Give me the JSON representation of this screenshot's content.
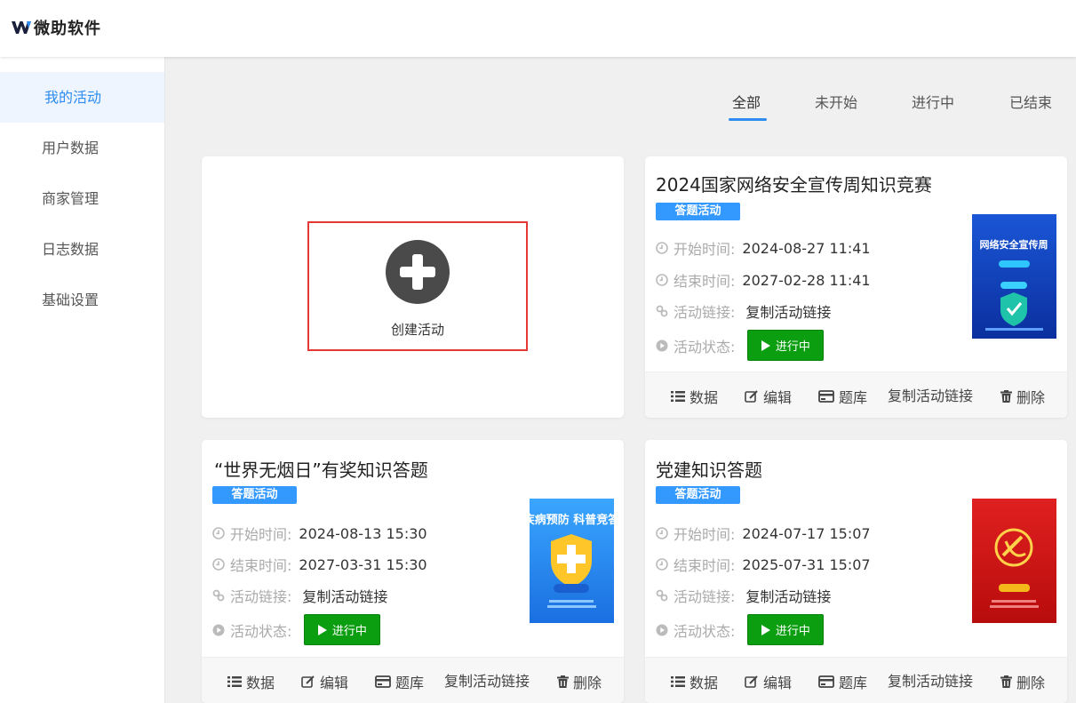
{
  "header": {
    "logo_text": "微助软件"
  },
  "sidebar": {
    "items": [
      {
        "label": "我的活动",
        "active": true
      },
      {
        "label": "用户数据"
      },
      {
        "label": "商家管理"
      },
      {
        "label": "日志数据"
      },
      {
        "label": "基础设置"
      }
    ]
  },
  "tabs": [
    {
      "label": "全部",
      "active": true
    },
    {
      "label": "未开始"
    },
    {
      "label": "进行中"
    },
    {
      "label": "已结束"
    }
  ],
  "create": {
    "label": "创建活动"
  },
  "labels": {
    "start": "开始时间:",
    "end": "结束时间:",
    "link": "活动链接:",
    "status": "活动状态:",
    "copy_link": "复制活动链接"
  },
  "actions": {
    "data": "数据",
    "edit": "编辑",
    "bank": "题库",
    "copy_link": "复制活动链接",
    "delete": "删除"
  },
  "activities": [
    {
      "title": "2024国家网络安全宣传周知识竞赛",
      "badge": "答题活动",
      "start": "2024-08-27 11:41",
      "end": "2027-02-28 11:41",
      "status": "进行中",
      "thumb_text": "网络安全宣传周"
    },
    {
      "title": "“世界无烟日”有奖知识答题",
      "badge": "答题活动",
      "start": "2024-08-13 15:30",
      "end": "2027-03-31 15:30",
      "status": "进行中",
      "thumb_text": "疾病预防 科普竞答"
    },
    {
      "title": "党建知识答题",
      "badge": "答题活动",
      "start": "2024-07-17 15:07",
      "end": "2025-07-31 15:07",
      "status": "进行中",
      "thumb_text": ""
    }
  ],
  "colors": {
    "accent": "#2d8cf0",
    "badge": "#3399ff",
    "status": "#0a9e10",
    "create_border": "#e53935"
  }
}
